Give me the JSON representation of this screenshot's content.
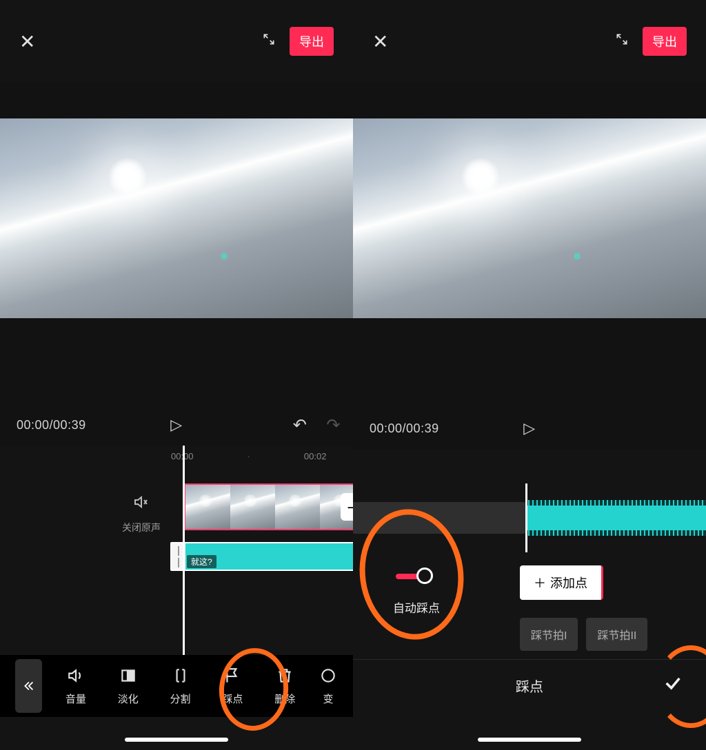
{
  "header": {
    "export_label": "导出"
  },
  "playback": {
    "time_display": "00:00/00:39"
  },
  "timeline": {
    "ruler": [
      "00:00",
      "00:02"
    ],
    "mute_label": "关闭原声",
    "audio_clip_label": "就这?"
  },
  "toolbar": {
    "items": [
      {
        "icon": "speaker-icon",
        "label": "音量"
      },
      {
        "icon": "fade-icon",
        "label": "淡化"
      },
      {
        "icon": "split-icon",
        "label": "分割"
      },
      {
        "icon": "flag-icon",
        "label": "踩点"
      },
      {
        "icon": "trash-icon",
        "label": "删除"
      },
      {
        "icon": "variable-icon",
        "label": "变"
      }
    ]
  },
  "beat_panel": {
    "add_point_label": "添加点",
    "auto_beat_label": "自动踩点",
    "options": [
      "踩节拍I",
      "踩节拍II"
    ],
    "footer_title": "踩点"
  }
}
